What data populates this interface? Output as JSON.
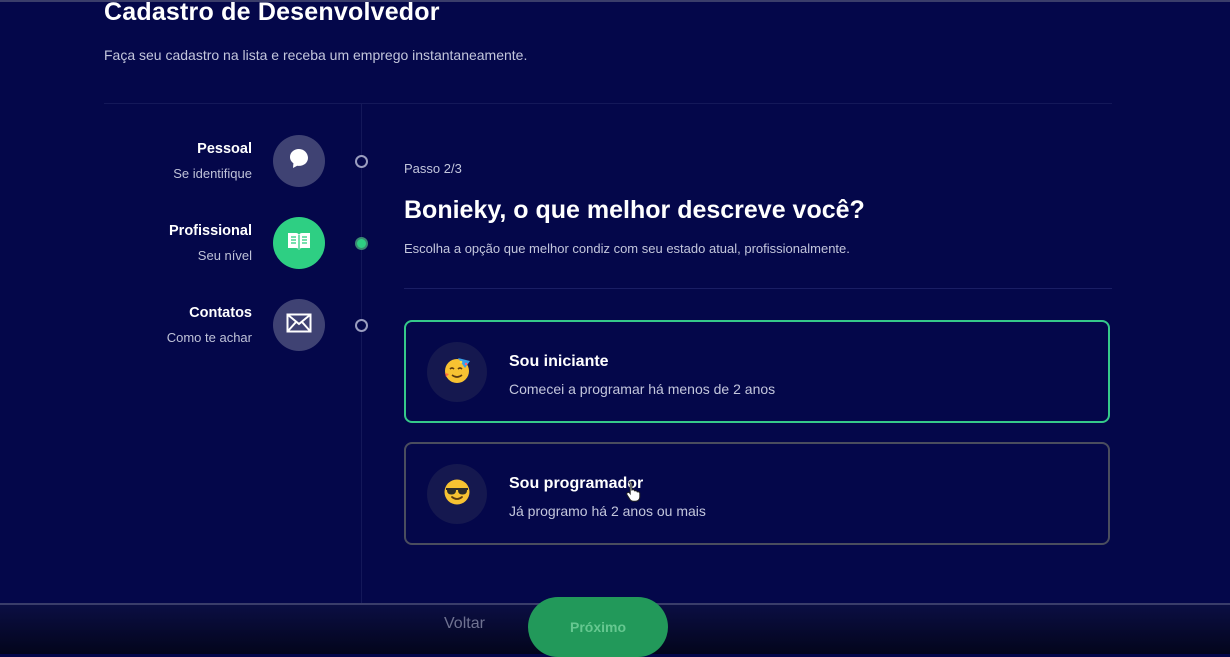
{
  "header": {
    "title": "Cadastro de Desenvolvedor",
    "subtitle": "Faça seu cadastro na lista e receba um emprego instantaneamente."
  },
  "steps": [
    {
      "label": "Pessoal",
      "sub": "Se identifique",
      "icon": "chat-bubble-icon",
      "active": false
    },
    {
      "label": "Profissional",
      "sub": "Seu nível",
      "icon": "book-icon",
      "active": true
    },
    {
      "label": "Contatos",
      "sub": "Como te achar",
      "icon": "envelope-icon",
      "active": false
    }
  ],
  "form": {
    "step_indicator": "Passo 2/3",
    "question": "Bonieky, o que melhor descreve você?",
    "description": "Escolha a opção que melhor condiz com seu estado atual, profissionalmente."
  },
  "options": [
    {
      "title": "Sou iniciante",
      "desc": "Comecei a programar há menos de 2 anos",
      "icon": "party-face-emoji",
      "selected": true
    },
    {
      "title": "Sou programador",
      "desc": "Já programo há 2 anos ou mais",
      "icon": "sunglasses-face-emoji",
      "selected": false
    }
  ],
  "footer": {
    "back_label": "Voltar",
    "next_label": "Próximo"
  },
  "colors": {
    "background": "#04074a",
    "accent": "#2ecf83",
    "button": "#22995a"
  }
}
